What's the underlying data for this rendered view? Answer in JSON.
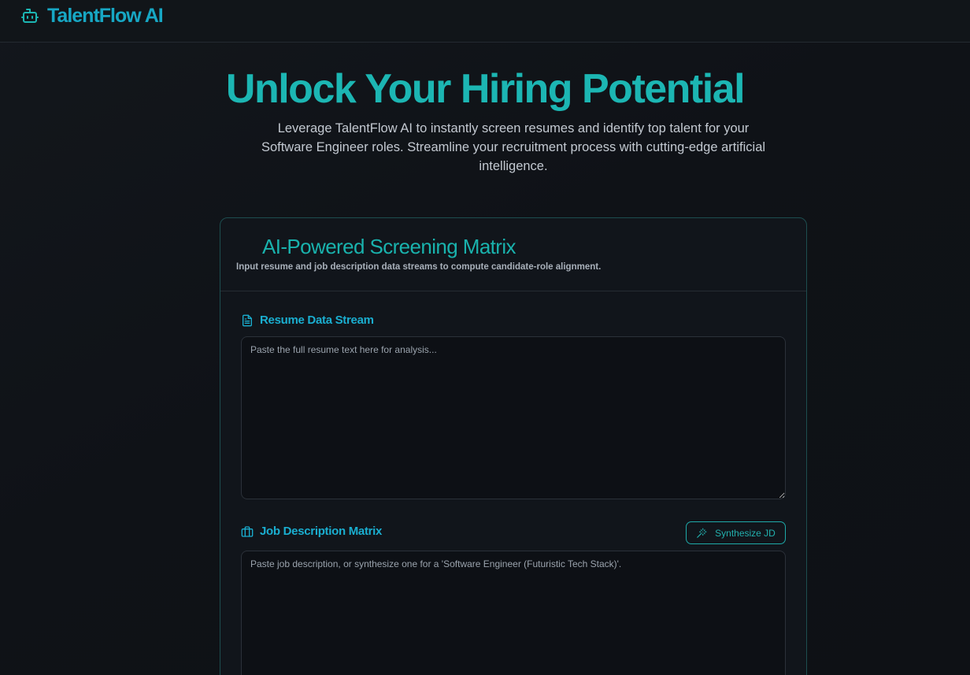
{
  "header": {
    "brand_name": "TalentFlow AI",
    "brand_icon": "bot-icon"
  },
  "hero": {
    "title": "Unlock Your Hiring Potential",
    "subtitle": "Leverage TalentFlow AI to instantly screen resumes and identify top talent for your Software Engineer roles. Streamline your recruitment process with cutting-edge artificial intelligence."
  },
  "card": {
    "title": "AI-Powered Screening Matrix",
    "description": "Input resume and job description data streams to compute candidate-role alignment."
  },
  "resume": {
    "label": "Resume Data Stream",
    "icon": "file-text-icon",
    "value": "",
    "placeholder": "Paste the full resume text here for analysis..."
  },
  "job_description": {
    "label": "Job Description Matrix",
    "icon": "briefcase-icon",
    "value": "",
    "placeholder": "Paste job description, or synthesize one for a 'Software Engineer (Futuristic Tech Stack)'.",
    "synthesize_label": "Synthesize JD",
    "synthesize_icon": "wand-icon"
  },
  "colors": {
    "accent": "#1cb6b3",
    "brand": "#17a7c4",
    "background": "#0e1116",
    "card_border": "#1d4d4f"
  }
}
